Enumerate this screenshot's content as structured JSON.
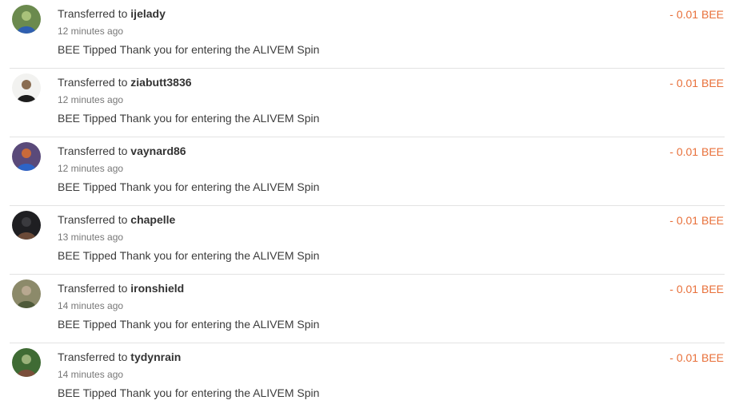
{
  "transfers": [
    {
      "prefix": "Transferred to",
      "user": "ijelady",
      "time": "12 minutes ago",
      "memo": "BEE Tipped Thank you for entering the ALIVEM Spin",
      "amount": "- 0.01 BEE",
      "avatar_colors": [
        "#6b8a4e",
        "#2f5fb0",
        "#a9c27a"
      ]
    },
    {
      "prefix": "Transferred to",
      "user": "ziabutt3836",
      "time": "12 minutes ago",
      "memo": "BEE Tipped Thank you for entering the ALIVEM Spin",
      "amount": "- 0.01 BEE",
      "avatar_colors": [
        "#f2f2f0",
        "#1d1d1d",
        "#8a6d52"
      ]
    },
    {
      "prefix": "Transferred to",
      "user": "vaynard86",
      "time": "12 minutes ago",
      "memo": "BEE Tipped Thank you for entering the ALIVEM Spin",
      "amount": "- 0.01 BEE",
      "avatar_colors": [
        "#5a4a7a",
        "#2d64c8",
        "#c86a3a"
      ]
    },
    {
      "prefix": "Transferred to",
      "user": "chapelle",
      "time": "13 minutes ago",
      "memo": "BEE Tipped Thank you for entering the ALIVEM Spin",
      "amount": "- 0.01 BEE",
      "avatar_colors": [
        "#1f1f22",
        "#6b4a38",
        "#3a3a3e"
      ]
    },
    {
      "prefix": "Transferred to",
      "user": "ironshield",
      "time": "14 minutes ago",
      "memo": "BEE Tipped Thank you for entering the ALIVEM Spin",
      "amount": "- 0.01 BEE",
      "avatar_colors": [
        "#8c8a6a",
        "#4f5a3a",
        "#b8a890"
      ]
    },
    {
      "prefix": "Transferred to",
      "user": "tydynrain",
      "time": "14 minutes ago",
      "memo": "BEE Tipped Thank you for entering the ALIVEM Spin",
      "amount": "- 0.01 BEE",
      "avatar_colors": [
        "#3f6b34",
        "#7a4e3a",
        "#9ab27a"
      ]
    }
  ]
}
